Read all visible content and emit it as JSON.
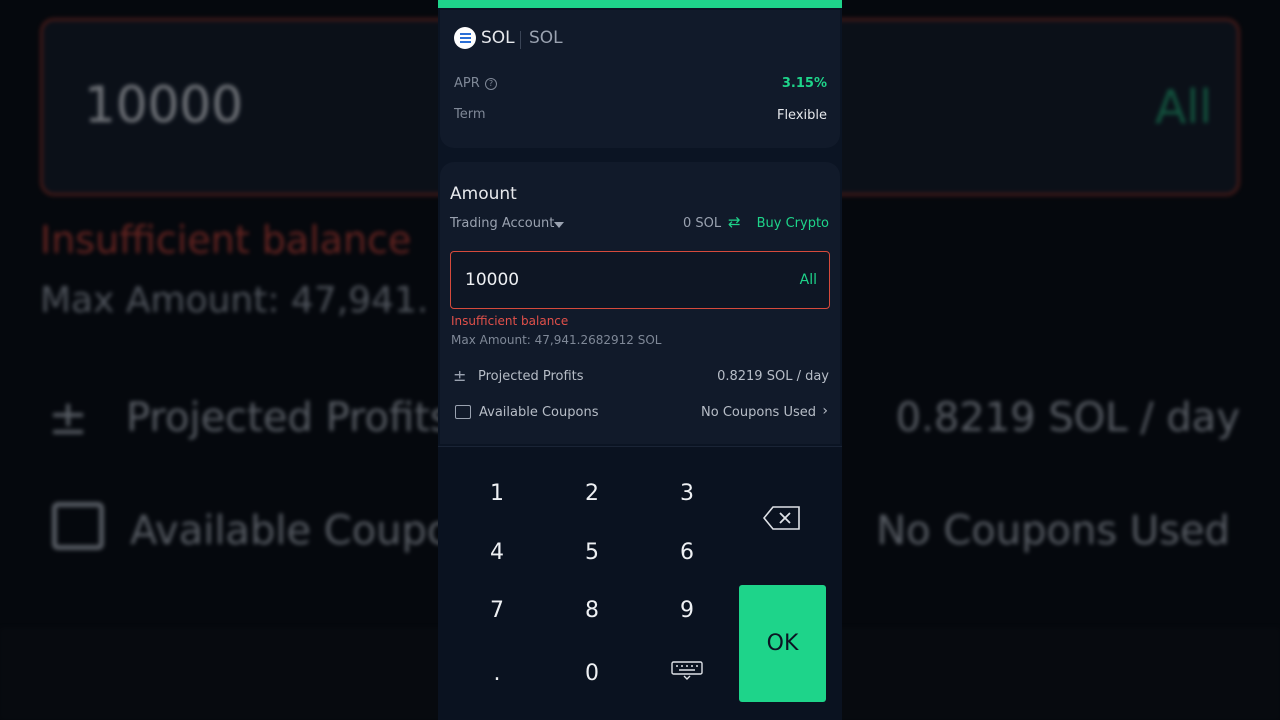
{
  "background": {
    "input_value": "10000",
    "all_label": "All",
    "error": "Insufficient balance",
    "max_amount": "Max Amount: 47,941.",
    "projected_label": "Projected Profits",
    "projected_value": "0.8219 SOL / day",
    "coupons_label": "Available Coupo",
    "coupons_value": "No Coupons Used"
  },
  "header": {
    "coin": "SOL",
    "coin_sub": "SOL",
    "apr_label": "APR",
    "apr_value": "3.15%",
    "term_label": "Term",
    "term_value": "Flexible"
  },
  "amount": {
    "title": "Amount",
    "account": "Trading Account",
    "balance": "0 SOL",
    "buy_link": "Buy Crypto",
    "input_value": "10000",
    "all_label": "All",
    "error": "Insufficient balance",
    "max_amount": "Max Amount: 47,941.2682912 SOL",
    "projected_label": "Projected Profits",
    "projected_value": "0.8219 SOL / day",
    "coupons_label": "Available Coupons",
    "coupons_value": "No Coupons Used"
  },
  "keypad": {
    "keys": [
      "1",
      "2",
      "3",
      "4",
      "5",
      "6",
      "7",
      "8",
      "9",
      ".",
      "0"
    ],
    "ok_label": "OK"
  },
  "colors": {
    "accent": "#1ed48a",
    "error": "#e0504a",
    "panel": "#111a2a"
  }
}
